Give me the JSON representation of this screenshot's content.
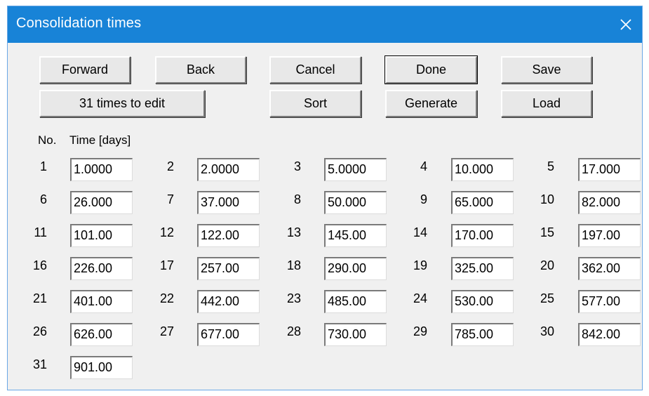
{
  "window": {
    "title": "Consolidation times"
  },
  "buttons": {
    "forward": "Forward",
    "back": "Back",
    "cancel": "Cancel",
    "done": "Done",
    "save": "Save",
    "times_to_edit": "31 times to edit",
    "sort": "Sort",
    "generate": "Generate",
    "load": "Load"
  },
  "headers": {
    "no": "No.",
    "time": "Time [days]"
  },
  "times": [
    {
      "no": "1",
      "value": "1.0000"
    },
    {
      "no": "2",
      "value": "2.0000"
    },
    {
      "no": "3",
      "value": "5.0000"
    },
    {
      "no": "4",
      "value": "10.000"
    },
    {
      "no": "5",
      "value": "17.000"
    },
    {
      "no": "6",
      "value": "26.000"
    },
    {
      "no": "7",
      "value": "37.000"
    },
    {
      "no": "8",
      "value": "50.000"
    },
    {
      "no": "9",
      "value": "65.000"
    },
    {
      "no": "10",
      "value": "82.000"
    },
    {
      "no": "11",
      "value": "101.00"
    },
    {
      "no": "12",
      "value": "122.00"
    },
    {
      "no": "13",
      "value": "145.00"
    },
    {
      "no": "14",
      "value": "170.00"
    },
    {
      "no": "15",
      "value": "197.00"
    },
    {
      "no": "16",
      "value": "226.00"
    },
    {
      "no": "17",
      "value": "257.00"
    },
    {
      "no": "18",
      "value": "290.00"
    },
    {
      "no": "19",
      "value": "325.00"
    },
    {
      "no": "20",
      "value": "362.00"
    },
    {
      "no": "21",
      "value": "401.00"
    },
    {
      "no": "22",
      "value": "442.00"
    },
    {
      "no": "23",
      "value": "485.00"
    },
    {
      "no": "24",
      "value": "530.00"
    },
    {
      "no": "25",
      "value": "577.00"
    },
    {
      "no": "26",
      "value": "626.00"
    },
    {
      "no": "27",
      "value": "677.00"
    },
    {
      "no": "28",
      "value": "730.00"
    },
    {
      "no": "29",
      "value": "785.00"
    },
    {
      "no": "30",
      "value": "842.00"
    },
    {
      "no": "31",
      "value": "901.00"
    }
  ],
  "icons": {
    "close": "close-icon"
  },
  "colors": {
    "titlebar": "#1883d7",
    "dialog_bg": "#f0f0f0"
  }
}
